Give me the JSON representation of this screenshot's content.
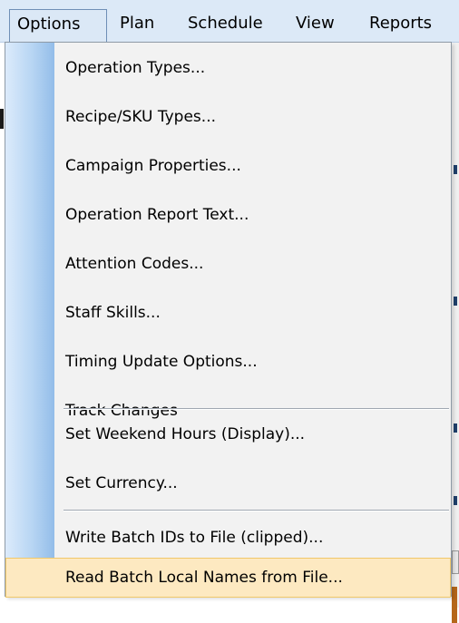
{
  "menubar": {
    "items": [
      {
        "label": "Options"
      },
      {
        "label": "Plan"
      },
      {
        "label": "Schedule"
      },
      {
        "label": "View"
      },
      {
        "label": "Reports"
      }
    ]
  },
  "options_menu": {
    "items": [
      {
        "label": "Operation Types..."
      },
      {
        "label": "Recipe/SKU Types..."
      },
      {
        "label": "Campaign Properties..."
      },
      {
        "label": "Operation Report Text..."
      },
      {
        "label": "Attention Codes..."
      },
      {
        "label": "Staff Skills..."
      },
      {
        "label": "Timing Update Options..."
      },
      {
        "label": "Track Changes"
      },
      {
        "label": "Set Weekend Hours (Display)..."
      },
      {
        "label": "Set Currency..."
      },
      {
        "label": "Write Batch IDs to File (clipped)..."
      },
      {
        "label": "Read Batch Local Names from File..."
      }
    ],
    "highlighted_index": 11
  },
  "colors": {
    "highlight_fill": "#fde9c1",
    "highlight_border": "#f0c86a",
    "gutter": "#93bde9"
  }
}
